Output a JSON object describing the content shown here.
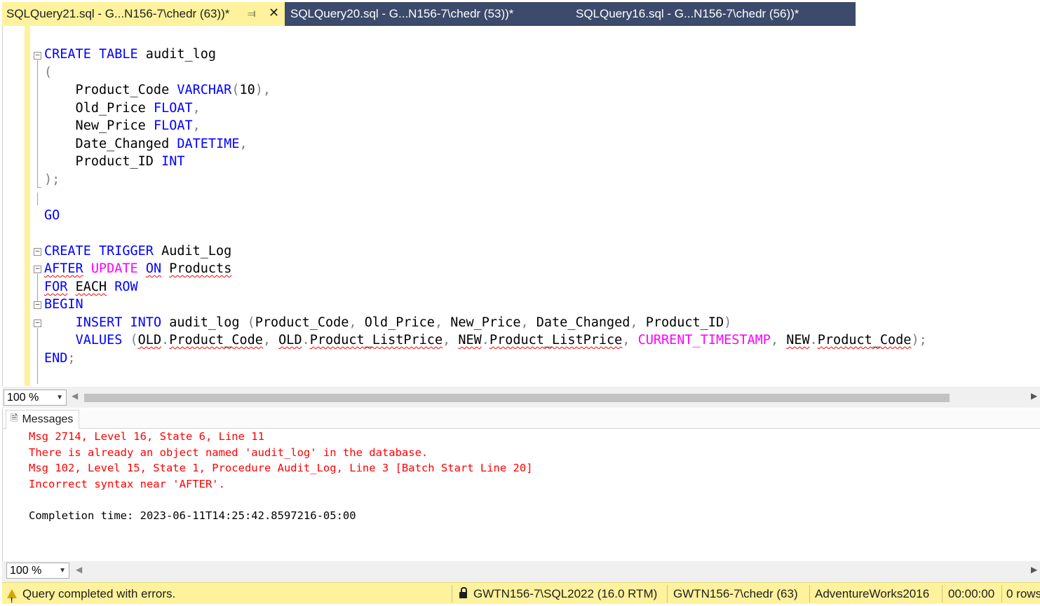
{
  "tabs": [
    {
      "label": "SQLQuery21.sql - G...N156-7\\chedr (63))*",
      "active": true
    },
    {
      "label": "SQLQuery20.sql - G...N156-7\\chedr (53))*",
      "active": false
    },
    {
      "label": "SQLQuery16.sql - G...N156-7\\chedr (56))*",
      "active": false
    }
  ],
  "tab_icons": {
    "pin": "pin-icon",
    "close": "close-icon"
  },
  "code": {
    "l1": {
      "a": "CREATE",
      "b": " ",
      "c": "TABLE",
      "d": " audit_log"
    },
    "l2": {
      "a": "("
    },
    "l3": {
      "a": "    Product_Code ",
      "b": "VARCHAR",
      "c": "(",
      "d": "10",
      "e": "),"
    },
    "l4": {
      "a": "    Old_Price ",
      "b": "FLOAT",
      "c": ","
    },
    "l5": {
      "a": "    New_Price ",
      "b": "FLOAT",
      "c": ","
    },
    "l6": {
      "a": "    Date_Changed ",
      "b": "DATETIME",
      "c": ","
    },
    "l7": {
      "a": "    Product_ID ",
      "b": "INT"
    },
    "l8": {
      "a": ");"
    },
    "l9": {
      "a": "GO"
    },
    "l10": {
      "a": "CREATE",
      "b": " ",
      "c": "TRIGGER",
      "d": " Audit_Log"
    },
    "l11": {
      "a": "AFTER",
      "b": " ",
      "c": "UPDATE",
      "d": " ",
      "e": "ON",
      "f": " ",
      "g": "Products"
    },
    "l12": {
      "a": "FOR",
      "b": " ",
      "c": "EACH",
      "d": " ",
      "e": "ROW"
    },
    "l13": {
      "a": "BEGIN"
    },
    "l14": {
      "a": "    ",
      "b": "INSERT",
      "c": " ",
      "d": "INTO",
      "e": " audit_log ",
      "f": "(",
      "g": "Product_Code",
      "h": ", ",
      "i": "Old_Price",
      "j": ", ",
      "k": "New_Price",
      "l": ", ",
      "m": "Date_Changed",
      "n": ", ",
      "o": "Product_ID",
      "p": ")"
    },
    "l15": {
      "a": "    ",
      "b": "VALUES",
      "c": " ",
      "d": "(",
      "e": "OLD",
      "f": ".",
      "g": "Product_Code",
      "h": ", ",
      "i": "OLD",
      "j": ".",
      "k": "Product_ListPrice",
      "l": ", ",
      "m": "NEW",
      "n": ".",
      "o": "Product_ListPrice",
      "p": ", ",
      "q": "CURRENT_TIMESTAMP",
      "r": ", ",
      "s": "NEW",
      "t": ".",
      "u": "Product_Code",
      "v": ");"
    },
    "l16": {
      "a": "END",
      "b": ";"
    }
  },
  "editor_zoom": "100 %",
  "messages_tab": {
    "label": "Messages",
    "icon": "messages-icon"
  },
  "messages": [
    {
      "text": "Msg 2714, Level 16, State 6, Line 11",
      "type": "error"
    },
    {
      "text": "There is already an object named 'audit_log' in the database.",
      "type": "error"
    },
    {
      "text": "Msg 102, Level 15, State 1, Procedure Audit_Log, Line 3 [Batch Start Line 20]",
      "type": "error"
    },
    {
      "text": "Incorrect syntax near 'AFTER'.",
      "type": "error"
    },
    {
      "text": "Completion time: 2023-06-11T14:25:42.8597216-05:00",
      "type": "normal"
    }
  ],
  "results_zoom": "100 %",
  "status": {
    "message": "Query completed with errors.",
    "server": "GWTN156-7\\SQL2022 (16.0 RTM)",
    "user": "GWTN156-7\\chedr (63)",
    "database": "AdventureWorks2016",
    "elapsed": "00:00:00",
    "rows": "0 rows"
  },
  "colors": {
    "accent_yellow": "#fff29d",
    "tab_inactive": "#3c4a6b",
    "keyword_blue": "#0000ff",
    "function_magenta": "#ff00ff",
    "operator_gray": "#808080",
    "error_red": "#ff0000"
  }
}
